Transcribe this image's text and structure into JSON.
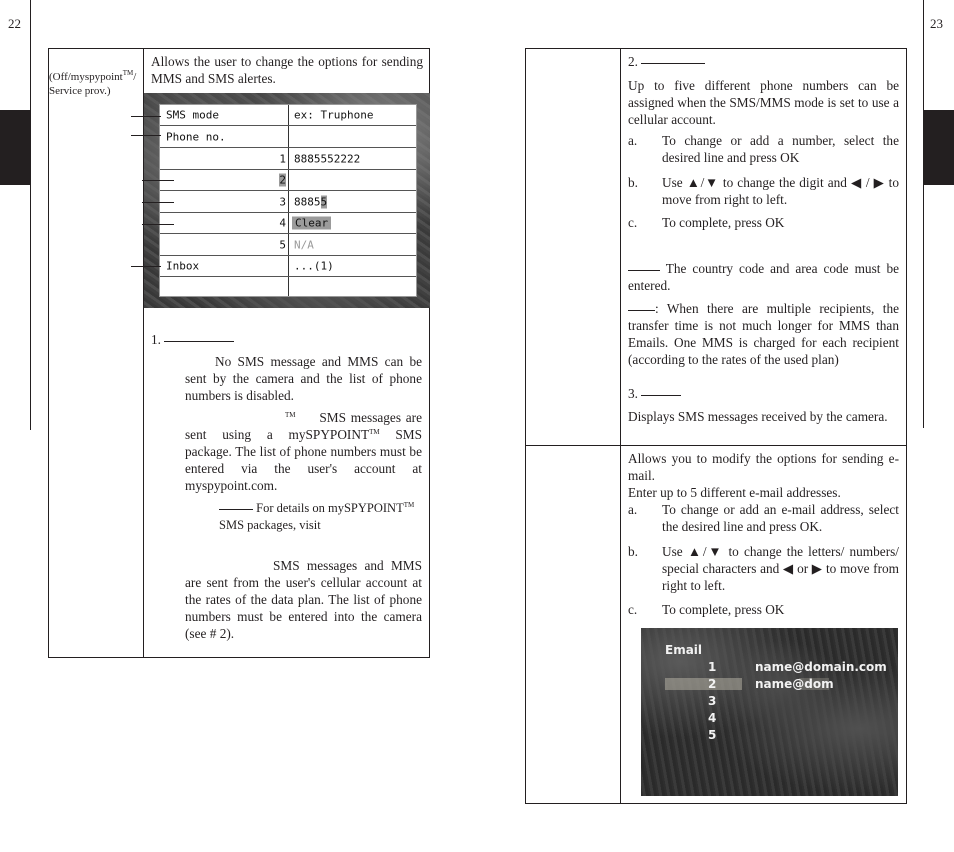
{
  "left_page": {
    "page_number": "22",
    "table": {
      "row1_label_line1": "(Off/myspypoint",
      "row1_label_tm": "TM",
      "row1_label_line1_end": "/",
      "row1_label_line2": "Service prov.)",
      "intro": "Allows the user to change the options for sending MMS and SMS alertes.",
      "sms_menu": {
        "rows": [
          {
            "label": "SMS mode",
            "num": "",
            "value": "ex: Truphone"
          },
          {
            "label": "Phone no.",
            "num": "",
            "value": ""
          },
          {
            "label": "",
            "num": "1",
            "value": "8885552222"
          },
          {
            "label": "",
            "num": "2",
            "value": ""
          },
          {
            "label": "",
            "num": "3",
            "value": "8885",
            "value_cursor": "5"
          },
          {
            "label": "",
            "num": "4",
            "value": "Clear"
          },
          {
            "label": "",
            "num": "5",
            "value": "N/A"
          },
          {
            "label": "Inbox",
            "num": "",
            "value": "...(1)"
          },
          {
            "label": "",
            "num": "",
            "value": ""
          }
        ]
      },
      "section1": {
        "number": "1.",
        "off_text": "No SMS message and MMS can be sent by the camera and the list of phone numbers is disabled.",
        "myspypoint_tm": "TM",
        "myspypoint_text_a": "SMS messages are sent using a mySPYPOINT",
        "myspypoint_text_tm": "TM",
        "myspypoint_text_b": " SMS package. The list of phone numbers must be entered via the user's account at myspypoint.com.",
        "note_text_a": " For details on mySPYPOINT",
        "note_text_tm": "TM",
        "note_text_b": " SMS packages, visit",
        "provider_text": "SMS messages and MMS are sent from the user's cellular account at the rates of the data plan. The list of phone numbers must be entered into the camera (see # 2)."
      }
    }
  },
  "right_page": {
    "page_number": "23",
    "section2": {
      "number": "2.",
      "intro": "Up to five different phone numbers can be assigned when the SMS/MMS mode is set to use a cellular account.",
      "steps": [
        {
          "letter": "a.",
          "text": "To change or add a number, select the desired line and press OK"
        },
        {
          "letter": "b.",
          "text": "Use ▲/▼ to change the digit and ◀ / ▶ to move from right to left."
        },
        {
          "letter": "c.",
          "text": "To complete, press OK"
        }
      ],
      "note1": " The country code and area code must be entered.",
      "note2": ": When there are multiple recipients, the transfer time is not much longer for MMS than Emails. One MMS is charged for each recipient (according to the rates of the used plan)"
    },
    "section3": {
      "number": "3.",
      "text": "Displays SMS messages received by the camera."
    },
    "email_section": {
      "intro": "Allows you to modify the options for sending e-mail.",
      "intro2": "Enter up to 5 different e-mail addresses.",
      "steps": [
        {
          "letter": "a.",
          "text": "To change or add an e-mail address, select the desired line and press OK."
        },
        {
          "letter": "b.",
          "text": "Use ▲/▼ to change the letters/ numbers/ special characters and ◀ or ▶ to move from right to left."
        },
        {
          "letter": "c.",
          "text": "To complete, press OK"
        }
      ],
      "email_screen": {
        "title": "Email",
        "rows": [
          {
            "num": "1",
            "value": "name@domain.com"
          },
          {
            "num": "2",
            "value": "name@dom"
          },
          {
            "num": "3",
            "value": ""
          },
          {
            "num": "4",
            "value": ""
          },
          {
            "num": "5",
            "value": ""
          }
        ]
      }
    }
  }
}
